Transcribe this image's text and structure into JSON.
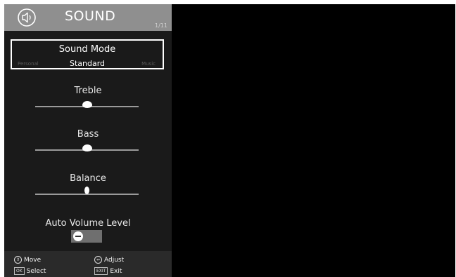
{
  "header": {
    "title": "SOUND",
    "page_indicator": "1/11",
    "icon": "speaker-icon"
  },
  "sound_mode": {
    "label": "Sound Mode",
    "current": "Standard",
    "previous": "Personal",
    "next": "Music"
  },
  "settings": {
    "treble": {
      "label": "Treble",
      "level": 0.5
    },
    "bass": {
      "label": "Bass",
      "level": 0.5
    },
    "balance": {
      "label": "Balance",
      "level": 0.5
    },
    "auto_volume": {
      "label": "Auto Volume Level",
      "state": "off"
    }
  },
  "footer": {
    "move_label": "Move",
    "adjust_label": "Adjust",
    "select_key": "OK",
    "select_label": "Select",
    "exit_key": "EXIT",
    "exit_label": "Exit"
  },
  "colors": {
    "panel_bg": "#1a1a1a",
    "header_bg": "#8f8f8f",
    "footer_bg": "#2a2a2a",
    "screen_bg": "#000000"
  }
}
